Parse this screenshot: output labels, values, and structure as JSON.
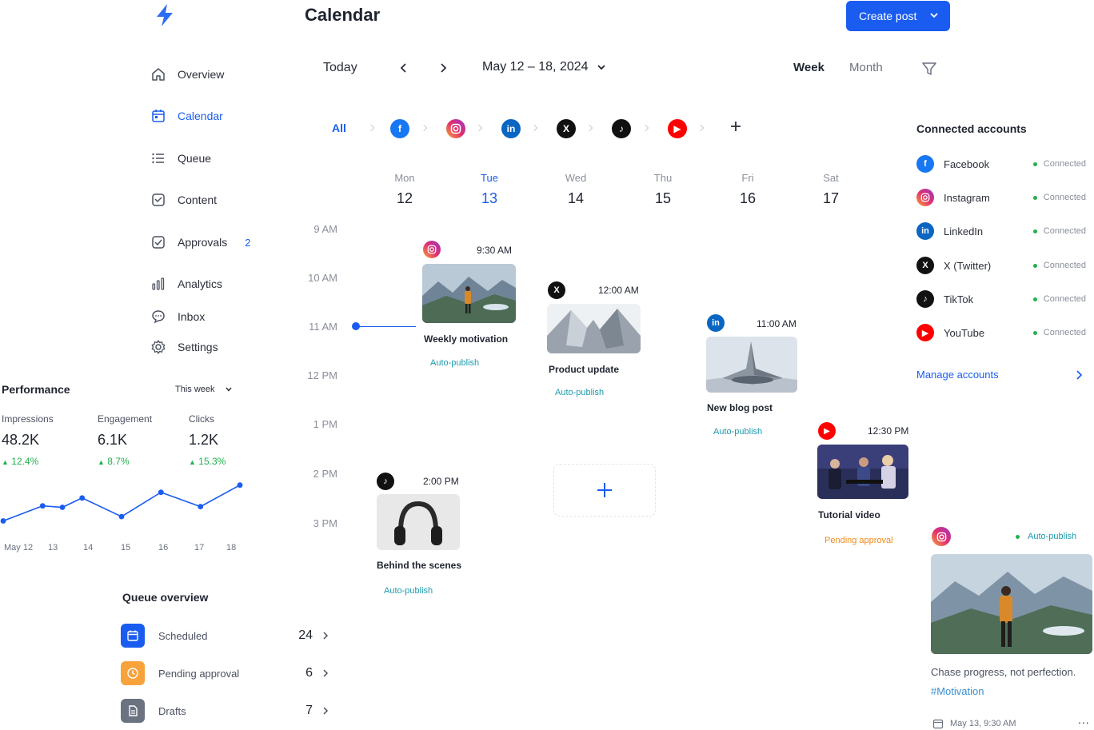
{
  "header": {
    "title": "Calendar",
    "create_label": "Create post"
  },
  "toolbar": {
    "today": "Today",
    "date_range": "May 12 – 18, 2024",
    "week": "Week",
    "month": "Month"
  },
  "sidebar": {
    "items": [
      {
        "label": "Overview"
      },
      {
        "label": "Calendar"
      },
      {
        "label": "Queue"
      },
      {
        "label": "Content"
      },
      {
        "label": "Approvals",
        "badge": "2"
      },
      {
        "label": "Analytics"
      },
      {
        "label": "Inbox"
      },
      {
        "label": "Settings"
      }
    ]
  },
  "filter": {
    "all": "All"
  },
  "days": [
    {
      "name": "Mon",
      "num": "12"
    },
    {
      "name": "Tue",
      "num": "13"
    },
    {
      "name": "Wed",
      "num": "14"
    },
    {
      "name": "Thu",
      "num": "15"
    },
    {
      "name": "Fri",
      "num": "16"
    },
    {
      "name": "Sat",
      "num": "17"
    }
  ],
  "times": [
    "9 AM",
    "10 AM",
    "11 AM",
    "12 PM",
    "1 PM",
    "2 PM",
    "3 PM"
  ],
  "posts": [
    {
      "title": "Weekly motivation",
      "time": "9:30 AM",
      "tag": "Auto-publish",
      "network": "instagram"
    },
    {
      "title": "Product update",
      "time": "12:00 AM",
      "tag": "Auto-publish",
      "network": "x"
    },
    {
      "title": "New blog post",
      "time": "11:00 AM",
      "tag": "Auto-publish",
      "network": "linkedin"
    },
    {
      "title": "Tutorial video",
      "time": "12:30 PM",
      "tag": "Pending approval",
      "network": "youtube"
    },
    {
      "title": "Behind the scenes",
      "time": "2:00 PM",
      "tag": "Auto-publish",
      "network": "tiktok"
    }
  ],
  "accounts": {
    "title": "Connected accounts",
    "items": [
      {
        "name": "Facebook",
        "status": "Connected"
      },
      {
        "name": "Instagram",
        "status": "Connected"
      },
      {
        "name": "LinkedIn",
        "status": "Connected"
      },
      {
        "name": "X (Twitter)",
        "status": "Connected"
      },
      {
        "name": "TikTok",
        "status": "Connected"
      },
      {
        "name": "YouTube",
        "status": "Connected"
      }
    ],
    "manage": "Manage accounts"
  },
  "preview": {
    "tag": "Auto-publish",
    "caption": "Chase progress, not perfection.",
    "hashtag": "#Motivation",
    "datetime": "May 13, 9:30 AM",
    "more": "..."
  },
  "performance": {
    "title": "Performance",
    "range": "This week",
    "metrics": [
      {
        "label": "Impressions",
        "value": "48.2K",
        "delta": "12.4%"
      },
      {
        "label": "Engagement",
        "value": "6.1K",
        "delta": "8.7%"
      },
      {
        "label": "Clicks",
        "value": "1.2K",
        "delta": "15.3%"
      }
    ]
  },
  "chart_data": {
    "type": "line",
    "x": [
      "May 12",
      "13",
      "14",
      "15",
      "16",
      "17",
      "18"
    ],
    "series": [
      {
        "values": [
          1,
          3.1,
          2.9,
          4.2,
          1.6,
          5.0,
          3.0,
          6.0
        ]
      }
    ],
    "x_points": [
      0,
      1,
      1.5,
      2,
      3,
      4,
      5,
      6
    ],
    "color": "#1a5cf0"
  },
  "queue": {
    "title": "Queue overview",
    "items": [
      {
        "label": "Scheduled",
        "count": "24",
        "color": "#1a5cf0"
      },
      {
        "label": "Pending approval",
        "count": "6",
        "color": "#f7a23b"
      },
      {
        "label": "Drafts",
        "count": "7",
        "color": "#6b7280"
      }
    ]
  },
  "colors": {
    "accent": "#1a5cf0",
    "success": "#22b14c",
    "pending": "#f08a1a"
  }
}
